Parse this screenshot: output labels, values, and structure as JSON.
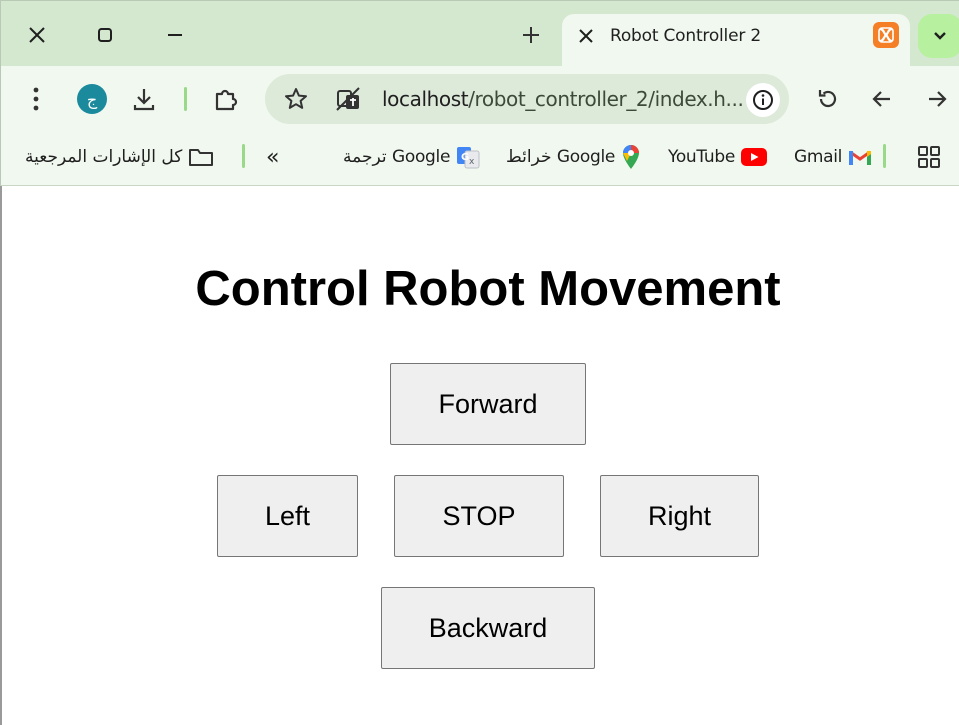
{
  "browser": {
    "tab": {
      "title": "Robot Controller 2"
    },
    "toolbar": {
      "avatar_initial": "ج",
      "url_host": "localhost",
      "url_path": "/robot_controller_2/index.h..."
    },
    "bookmarks": {
      "all_bookmarks": "كل الإشارات المرجعية",
      "more": "«",
      "items": [
        {
          "label": "ترجمة Google",
          "icon": "google-translate-icon"
        },
        {
          "label": "خرائط Google",
          "icon": "google-maps-icon"
        },
        {
          "label": "YouTube",
          "icon": "youtube-icon"
        },
        {
          "label": "Gmail",
          "icon": "gmail-icon"
        }
      ]
    }
  },
  "page": {
    "title": "Control Robot Movement",
    "buttons": {
      "forward": "Forward",
      "left": "Left",
      "stop": "STOP",
      "right": "Right",
      "backward": "Backward"
    }
  },
  "colors": {
    "tabstrip_bg": "#d3e8cf",
    "toolbar_bg": "#f1f8ef",
    "omnibox_bg": "#dde9d9",
    "button_bg": "#efefef",
    "button_border": "#767676"
  }
}
